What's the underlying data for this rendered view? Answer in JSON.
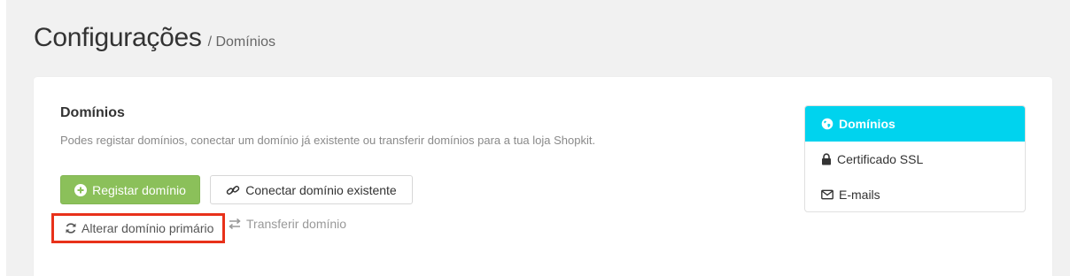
{
  "header": {
    "title": "Configurações",
    "breadcrumb": "/ Domínios"
  },
  "section": {
    "title": "Domínios",
    "description": "Podes registar domínios, conectar um domínio já existente ou transferir domínios para a tua loja Shopkit."
  },
  "actions": {
    "register_label": "Registar domínio",
    "connect_label": "Conectar domínio existente",
    "change_primary_label": "Alterar domínio primário",
    "transfer_label": "Transferir domínio"
  },
  "side_nav": {
    "items": [
      {
        "label": "Domínios",
        "icon": "globe-icon",
        "active": true
      },
      {
        "label": "Certificado SSL",
        "icon": "lock-icon",
        "active": false
      },
      {
        "label": "E-mails",
        "icon": "envelope-icon",
        "active": false
      }
    ]
  },
  "colors": {
    "primary_button": "#8bc05a",
    "active_nav": "#00d3ee",
    "highlight": "#e8311a"
  }
}
